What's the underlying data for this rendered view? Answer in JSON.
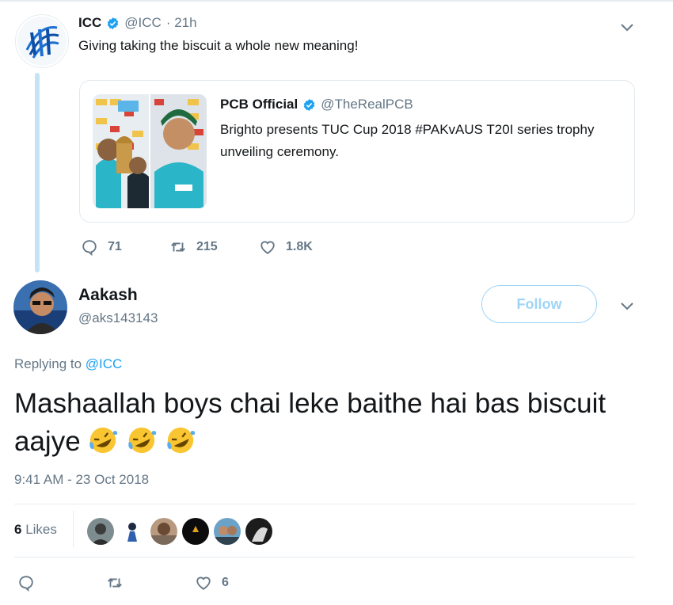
{
  "parent_tweet": {
    "name": "ICC",
    "handle": "@ICC",
    "time": "· 21h",
    "text": "Giving taking the biscuit a whole new meaning!",
    "quote": {
      "name": "PCB Official",
      "handle": "@TheRealPCB",
      "text": "Brighto presents TUC Cup 2018 #PAKvAUS T20I series trophy unveiling ceremony."
    },
    "actions": {
      "replies": "71",
      "retweets": "215",
      "likes": "1.8K"
    }
  },
  "reply_tweet": {
    "name": "Aakash",
    "handle": "@aks143143",
    "follow_label": "Follow",
    "replying_prefix": "Replying to",
    "replying_mention": "@ICC",
    "text": "Mashaallah boys chai leke baithe hai bas biscuit aajye",
    "emoji_count": 3,
    "timestamp": "9:41 AM - 23 Oct 2018",
    "likes_count": "6",
    "likes_label": "Likes",
    "actions": {
      "likes": "6"
    }
  },
  "colors": {
    "brand_blue": "#1da1f2",
    "follow_border": "#9fd4f6",
    "thread_line": "#c4e3f5",
    "like_red": "#e0245e",
    "muted_text": "#657786"
  }
}
